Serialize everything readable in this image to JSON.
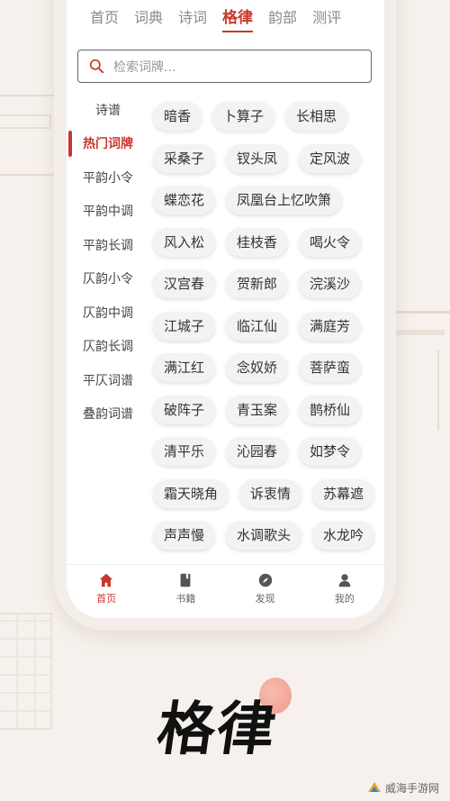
{
  "tabs": [
    {
      "label": "首页"
    },
    {
      "label": "词典"
    },
    {
      "label": "诗词"
    },
    {
      "label": "格律",
      "active": true
    },
    {
      "label": "韵部"
    },
    {
      "label": "测评"
    }
  ],
  "search": {
    "placeholder": "检索词牌..."
  },
  "side_nav": [
    {
      "label": "诗谱"
    },
    {
      "label": "热门词牌",
      "active": true
    },
    {
      "label": "平韵小令"
    },
    {
      "label": "平韵中调"
    },
    {
      "label": "平韵长调"
    },
    {
      "label": "仄韵小令"
    },
    {
      "label": "仄韵中调"
    },
    {
      "label": "仄韵长调"
    },
    {
      "label": "平仄词谱"
    },
    {
      "label": "叠韵词谱"
    }
  ],
  "chips": [
    [
      "暗香",
      "卜算子",
      "长相思"
    ],
    [
      "采桑子",
      "钗头凤",
      "定风波"
    ],
    [
      "蝶恋花",
      "凤凰台上忆吹箫"
    ],
    [
      "风入松",
      "桂枝香",
      "喝火令"
    ],
    [
      "汉宫春",
      "贺新郎",
      "浣溪沙"
    ],
    [
      "江城子",
      "临江仙",
      "满庭芳"
    ],
    [
      "满江红",
      "念奴娇",
      "菩萨蛮"
    ],
    [
      "破阵子",
      "青玉案",
      "鹊桥仙"
    ],
    [
      "清平乐",
      "沁园春",
      "如梦令"
    ],
    [
      "霜天晓角",
      "诉衷情",
      "苏幕遮"
    ],
    [
      "声声慢",
      "水调歌头",
      "水龙吟"
    ]
  ],
  "bottom_nav": [
    {
      "label": "首页",
      "icon": "home-icon",
      "active": true
    },
    {
      "label": "书籍",
      "icon": "book-icon"
    },
    {
      "label": "发现",
      "icon": "compass-icon"
    },
    {
      "label": "我的",
      "icon": "user-icon"
    }
  ],
  "title": "格律",
  "watermark": "威海手游网",
  "colors": {
    "accent": "#c8372d",
    "chip_bg": "#f4f3f3",
    "background": "#f6f1ec"
  }
}
